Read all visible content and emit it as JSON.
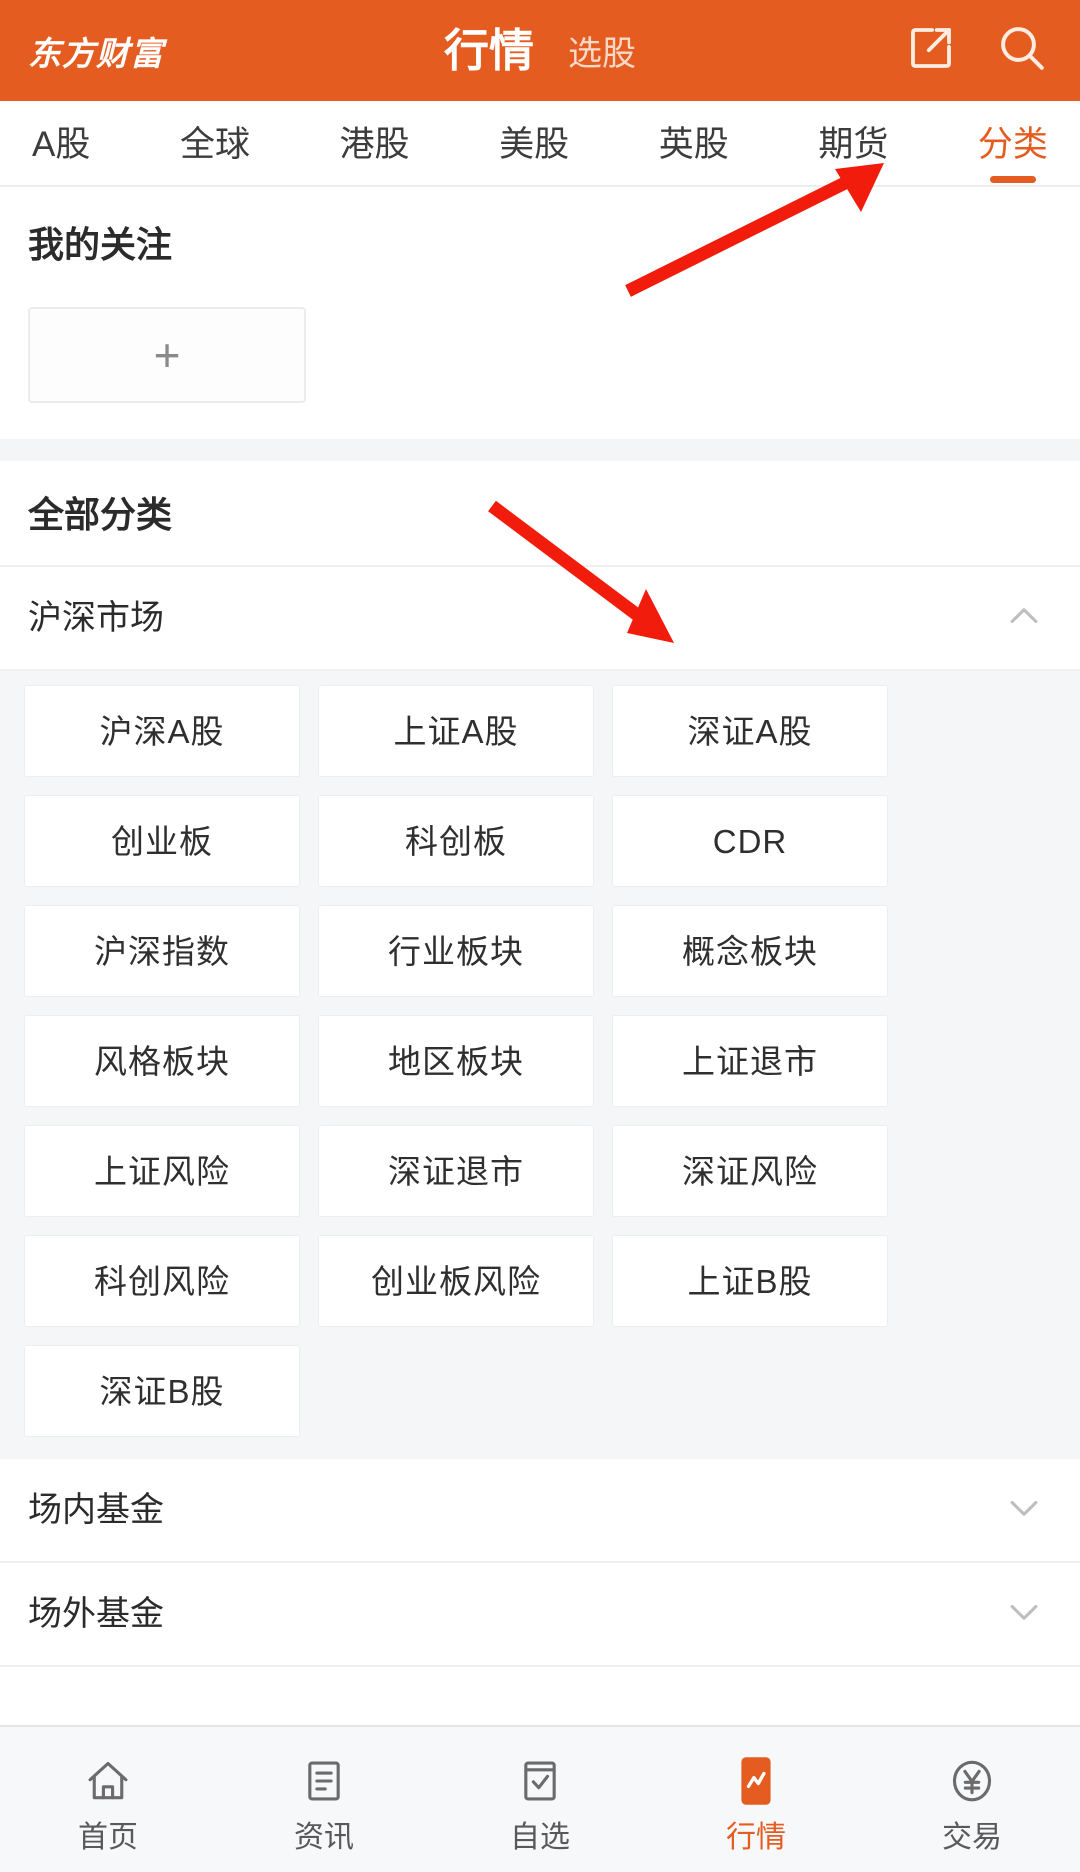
{
  "header": {
    "brand": "东方财富",
    "title_active": "行情",
    "title_inactive": "选股",
    "share_icon": "share-external-icon",
    "search_icon": "search-icon"
  },
  "tabs": [
    {
      "label": "A股",
      "active": false
    },
    {
      "label": "全球",
      "active": false
    },
    {
      "label": "港股",
      "active": false
    },
    {
      "label": "美股",
      "active": false
    },
    {
      "label": "英股",
      "active": false
    },
    {
      "label": "期货",
      "active": false
    },
    {
      "label": "分类",
      "active": true
    }
  ],
  "watchlist": {
    "title": "我的关注",
    "add_label": "+"
  },
  "all_categories": {
    "title": "全部分类",
    "groups": [
      {
        "label": "沪深市场",
        "expanded": true,
        "chevron": "chevron-up-icon",
        "items": [
          "沪深A股",
          "上证A股",
          "深证A股",
          "创业板",
          "科创板",
          "CDR",
          "沪深指数",
          "行业板块",
          "概念板块",
          "风格板块",
          "地区板块",
          "上证退市",
          "上证风险",
          "深证退市",
          "深证风险",
          "科创风险",
          "创业板风险",
          "上证B股",
          "深证B股"
        ]
      },
      {
        "label": "场内基金",
        "expanded": false,
        "chevron": "chevron-down-icon",
        "items": []
      },
      {
        "label": "场外基金",
        "expanded": false,
        "chevron": "chevron-down-icon",
        "items": []
      }
    ]
  },
  "bottom_nav": [
    {
      "label": "首页",
      "icon": "home-icon",
      "active": false
    },
    {
      "label": "资讯",
      "icon": "news-document-icon",
      "active": false
    },
    {
      "label": "自选",
      "icon": "checkbox-list-icon",
      "active": false
    },
    {
      "label": "行情",
      "icon": "chart-trend-icon",
      "active": true
    },
    {
      "label": "交易",
      "icon": "yen-circle-icon",
      "active": false
    }
  ],
  "annotations": {
    "arrow_color": "#f21c0d",
    "arrows": [
      {
        "name": "arrow-to-category-tab",
        "target": "分类"
      },
      {
        "name": "arrow-to-shenzhen-a-share",
        "target": "深证A股"
      }
    ]
  },
  "colors": {
    "brand_orange": "#e55c20",
    "page_bg": "#f5f6f8",
    "card_bg": "#ffffff",
    "text_primary": "#2b2b2b"
  }
}
